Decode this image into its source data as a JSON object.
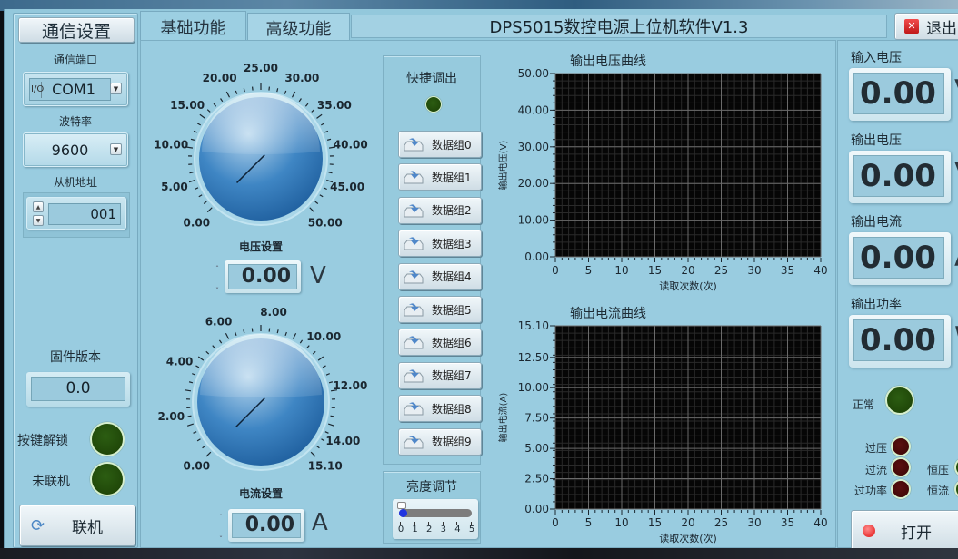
{
  "app": {
    "title": "DPS5015数控电源上位机软件V1.3",
    "exit_label": "退出",
    "tabs": [
      {
        "label": "基础功能",
        "active": true
      },
      {
        "label": "高级功能",
        "active": false
      }
    ]
  },
  "comm": {
    "title": "通信设置",
    "port_label": "通信端口",
    "port_value": "COM1",
    "port_icon": "io-icon",
    "baud_label": "波特率",
    "baud_value": "9600",
    "addr_label": "从机地址",
    "addr_value": "001",
    "firmware_label": "固件版本",
    "firmware_value": "0.0",
    "key_lock_label": "按键解锁",
    "not_connected_label": "未联机",
    "connect_label": "联机"
  },
  "voltage_knob": {
    "label": "电压设置",
    "ticks": [
      "0.00",
      "5.00",
      "10.00",
      "15.00",
      "20.00",
      "25.00",
      "30.00",
      "35.00",
      "40.00",
      "45.00",
      "50.00"
    ],
    "min": 0,
    "max": 50,
    "value": 0,
    "display": "0.00",
    "unit": "V"
  },
  "current_knob": {
    "label": "电流设置",
    "ticks": [
      "0.00",
      "2.00",
      "4.00",
      "6.00",
      "8.00",
      "10.00",
      "12.00",
      "14.00",
      "15.10"
    ],
    "tick_values": [
      0,
      2,
      4,
      6,
      8,
      10,
      12,
      14,
      15.1
    ],
    "min": 0,
    "max": 15.1,
    "value": 0,
    "display": "0.00",
    "unit": "A"
  },
  "quick": {
    "title": "快捷调出",
    "groups": [
      "数据组0",
      "数据组1",
      "数据组2",
      "数据组3",
      "数据组4",
      "数据组5",
      "数据组6",
      "数据组7",
      "数据组8",
      "数据组9"
    ]
  },
  "brightness": {
    "title": "亮度调节",
    "ticks": [
      "0",
      "1",
      "2",
      "3",
      "4",
      "5"
    ],
    "value": 0,
    "max": 5
  },
  "chart_data": [
    {
      "type": "line",
      "title": "输出电压曲线",
      "xlabel": "读取次数(次)",
      "ylabel": "输出电压(V)",
      "xlim": [
        0,
        40
      ],
      "ylim": [
        0,
        50
      ],
      "xticks": [
        "0",
        "5",
        "10",
        "15",
        "20",
        "25",
        "30",
        "35",
        "40"
      ],
      "yticks": [
        "0.00",
        "10.00",
        "20.00",
        "30.00",
        "40.00",
        "50.00"
      ],
      "grid": true,
      "series": []
    },
    {
      "type": "line",
      "title": "输出电流曲线",
      "xlabel": "读取次数(次)",
      "ylabel": "输出电流(A)",
      "xlim": [
        0,
        40
      ],
      "ylim": [
        0,
        15.1
      ],
      "xticks": [
        "0",
        "5",
        "10",
        "15",
        "20",
        "25",
        "30",
        "35",
        "40"
      ],
      "yticks": [
        "0.00",
        "2.50",
        "5.00",
        "7.50",
        "10.00",
        "12.50",
        "15.10"
      ],
      "ytick_values": [
        0,
        2.5,
        5,
        7.5,
        10,
        12.5,
        15.1
      ],
      "grid": true,
      "series": []
    }
  ],
  "readings": [
    {
      "label": "输入电压",
      "value": "0.00",
      "unit": "V"
    },
    {
      "label": "输出电压",
      "value": "0.00",
      "unit": "V"
    },
    {
      "label": "输出电流",
      "value": "0.00",
      "unit": "A"
    },
    {
      "label": "输出功率",
      "value": "0.00",
      "unit": "W"
    }
  ],
  "status": {
    "normal_label": "正常",
    "ovp_label": "过压",
    "ocp_label": "过流",
    "opp_label": "过功率",
    "cv_label": "恒压",
    "cc_label": "恒流",
    "open_label": "打开",
    "colors": {
      "green": "#234d0b",
      "red": "#4a0a0a"
    }
  }
}
